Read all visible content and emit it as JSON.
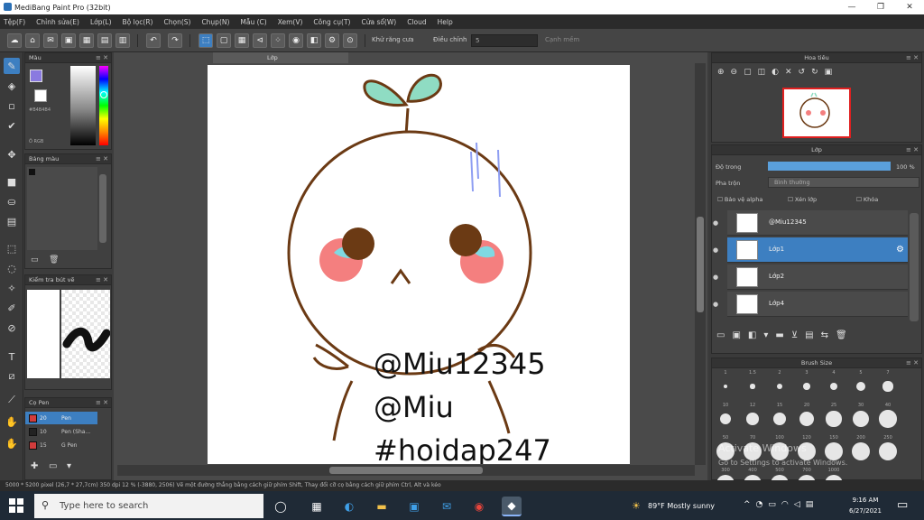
{
  "window": {
    "title": "MediBang Paint Pro (32bit)",
    "min": "—",
    "max": "❐",
    "close": "✕"
  },
  "menu": [
    "Tệp(F)",
    "Chỉnh sửa(E)",
    "Lớp(L)",
    "Bộ lọc(R)",
    "Chọn(S)",
    "Chụp(N)",
    "Mẫu (C)",
    "Xem(V)",
    "Công cụ(T)",
    "Cửa sổ(W)",
    "Cloud",
    "Help"
  ],
  "toolbar": {
    "auto_select_label": "Khử răng cưa",
    "adjust_label": "Điều chỉnh",
    "adjust_value": "5",
    "right_label": "Cạnh mềm"
  },
  "document": {
    "tab_title": "Lớp"
  },
  "panels": {
    "color": {
      "title": "Màu",
      "hex": "#B4B4B4",
      "rgb_label": "Ô RGB"
    },
    "palette": {
      "title": "Bảng màu"
    },
    "brush_control": {
      "title": "Kiểm tra bút vẽ"
    },
    "brush_list": {
      "title": "Cọ Pen",
      "items": [
        {
          "size": "20",
          "name": "Pen",
          "color": "#d23c3c"
        },
        {
          "size": "10",
          "name": "Pen (Sha...",
          "color": "#222222"
        },
        {
          "size": "15",
          "name": "G Pen",
          "color": "#d23c3c"
        }
      ]
    },
    "navigator": {
      "title": "Hoa tiêu"
    },
    "layer": {
      "title": "Lớp",
      "opacity_label": "Độ trong",
      "opacity_value": "100 %",
      "blend_label": "Pha trộn",
      "blend_value": "Bình thường",
      "protect_alpha": "Bảo vệ alpha",
      "clipping": "Xén lớp",
      "lock": "Khóa",
      "layers": [
        {
          "name": "@Miu12345"
        },
        {
          "name": "Lớp1"
        },
        {
          "name": "Lớp2"
        },
        {
          "name": "Lớp4"
        }
      ]
    },
    "brush_size": {
      "title": "Brush Size",
      "labels": [
        "1",
        "1.5",
        "2",
        "3",
        "4",
        "5",
        "7",
        "10",
        "12",
        "15",
        "20",
        "25",
        "30",
        "40",
        "50",
        "70",
        "100",
        "120",
        "150",
        "200",
        "250",
        "300",
        "400",
        "500",
        "700",
        "1000"
      ]
    }
  },
  "canvas_text": {
    "line1": "@Miu12345",
    "line2": "@Miu",
    "line3": "#hoidap247"
  },
  "watermark": {
    "line1": "Activate Windows",
    "line2": "Go to Settings to activate Windows."
  },
  "status": "5000 * 5200 pixel   (26,7 * 27,7cm)   350 dpi   12 %   (-3880, 2506)   Vẽ một đường thẳng bằng cách giữ phím Shift, Thay đổi cỡ cọ bằng cách giữ phím Ctrl, Alt và kéo",
  "taskbar": {
    "search_placeholder": "Type here to search",
    "weather": "89°F  Mostly sunny",
    "time": "9:16 AM",
    "date": "6/27/2021"
  }
}
